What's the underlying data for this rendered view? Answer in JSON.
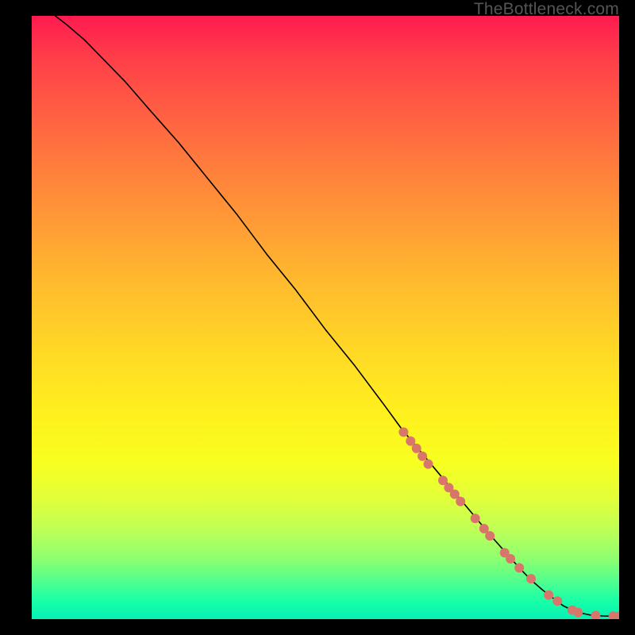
{
  "watermark": "TheBottleneck.com",
  "chart_data": {
    "type": "line",
    "title": "",
    "xlabel": "",
    "ylabel": "",
    "xlim": [
      0,
      100
    ],
    "ylim": [
      0,
      100
    ],
    "curve": {
      "name": "curve",
      "color": "#000000",
      "x": [
        4,
        6,
        9,
        12,
        16,
        20,
        25,
        30,
        35,
        40,
        45,
        50,
        55,
        60,
        63,
        66,
        69,
        72,
        75,
        78,
        81,
        83,
        85,
        87,
        89,
        90.5,
        92,
        93.5,
        95,
        96.5,
        98,
        100
      ],
      "y": [
        100,
        98.5,
        96,
        93,
        89,
        84.5,
        79,
        73,
        67,
        60.5,
        54.5,
        48,
        42,
        35.5,
        31.5,
        28,
        24.5,
        21,
        17.5,
        14,
        10.7,
        8.5,
        6.5,
        4.8,
        3.3,
        2.2,
        1.5,
        1.0,
        0.7,
        0.55,
        0.5,
        0.5
      ]
    },
    "markers": {
      "name": "points",
      "color": "#d9766c",
      "radius": 6,
      "x": [
        63.3,
        64.5,
        65.5,
        66.5,
        67.5,
        70.0,
        71.0,
        72.0,
        73.0,
        75.5,
        77.0,
        78.0,
        80.5,
        81.5,
        83.0,
        85.0,
        88.0,
        89.5,
        92.0,
        93.0,
        96.0,
        99.0,
        100.0
      ],
      "y": [
        31.0,
        29.5,
        28.3,
        27.0,
        25.7,
        23.0,
        21.8,
        20.7,
        19.5,
        16.7,
        15.0,
        13.8,
        11.0,
        10.0,
        8.5,
        6.7,
        4.0,
        3.0,
        1.5,
        1.1,
        0.6,
        0.5,
        0.5
      ]
    }
  }
}
